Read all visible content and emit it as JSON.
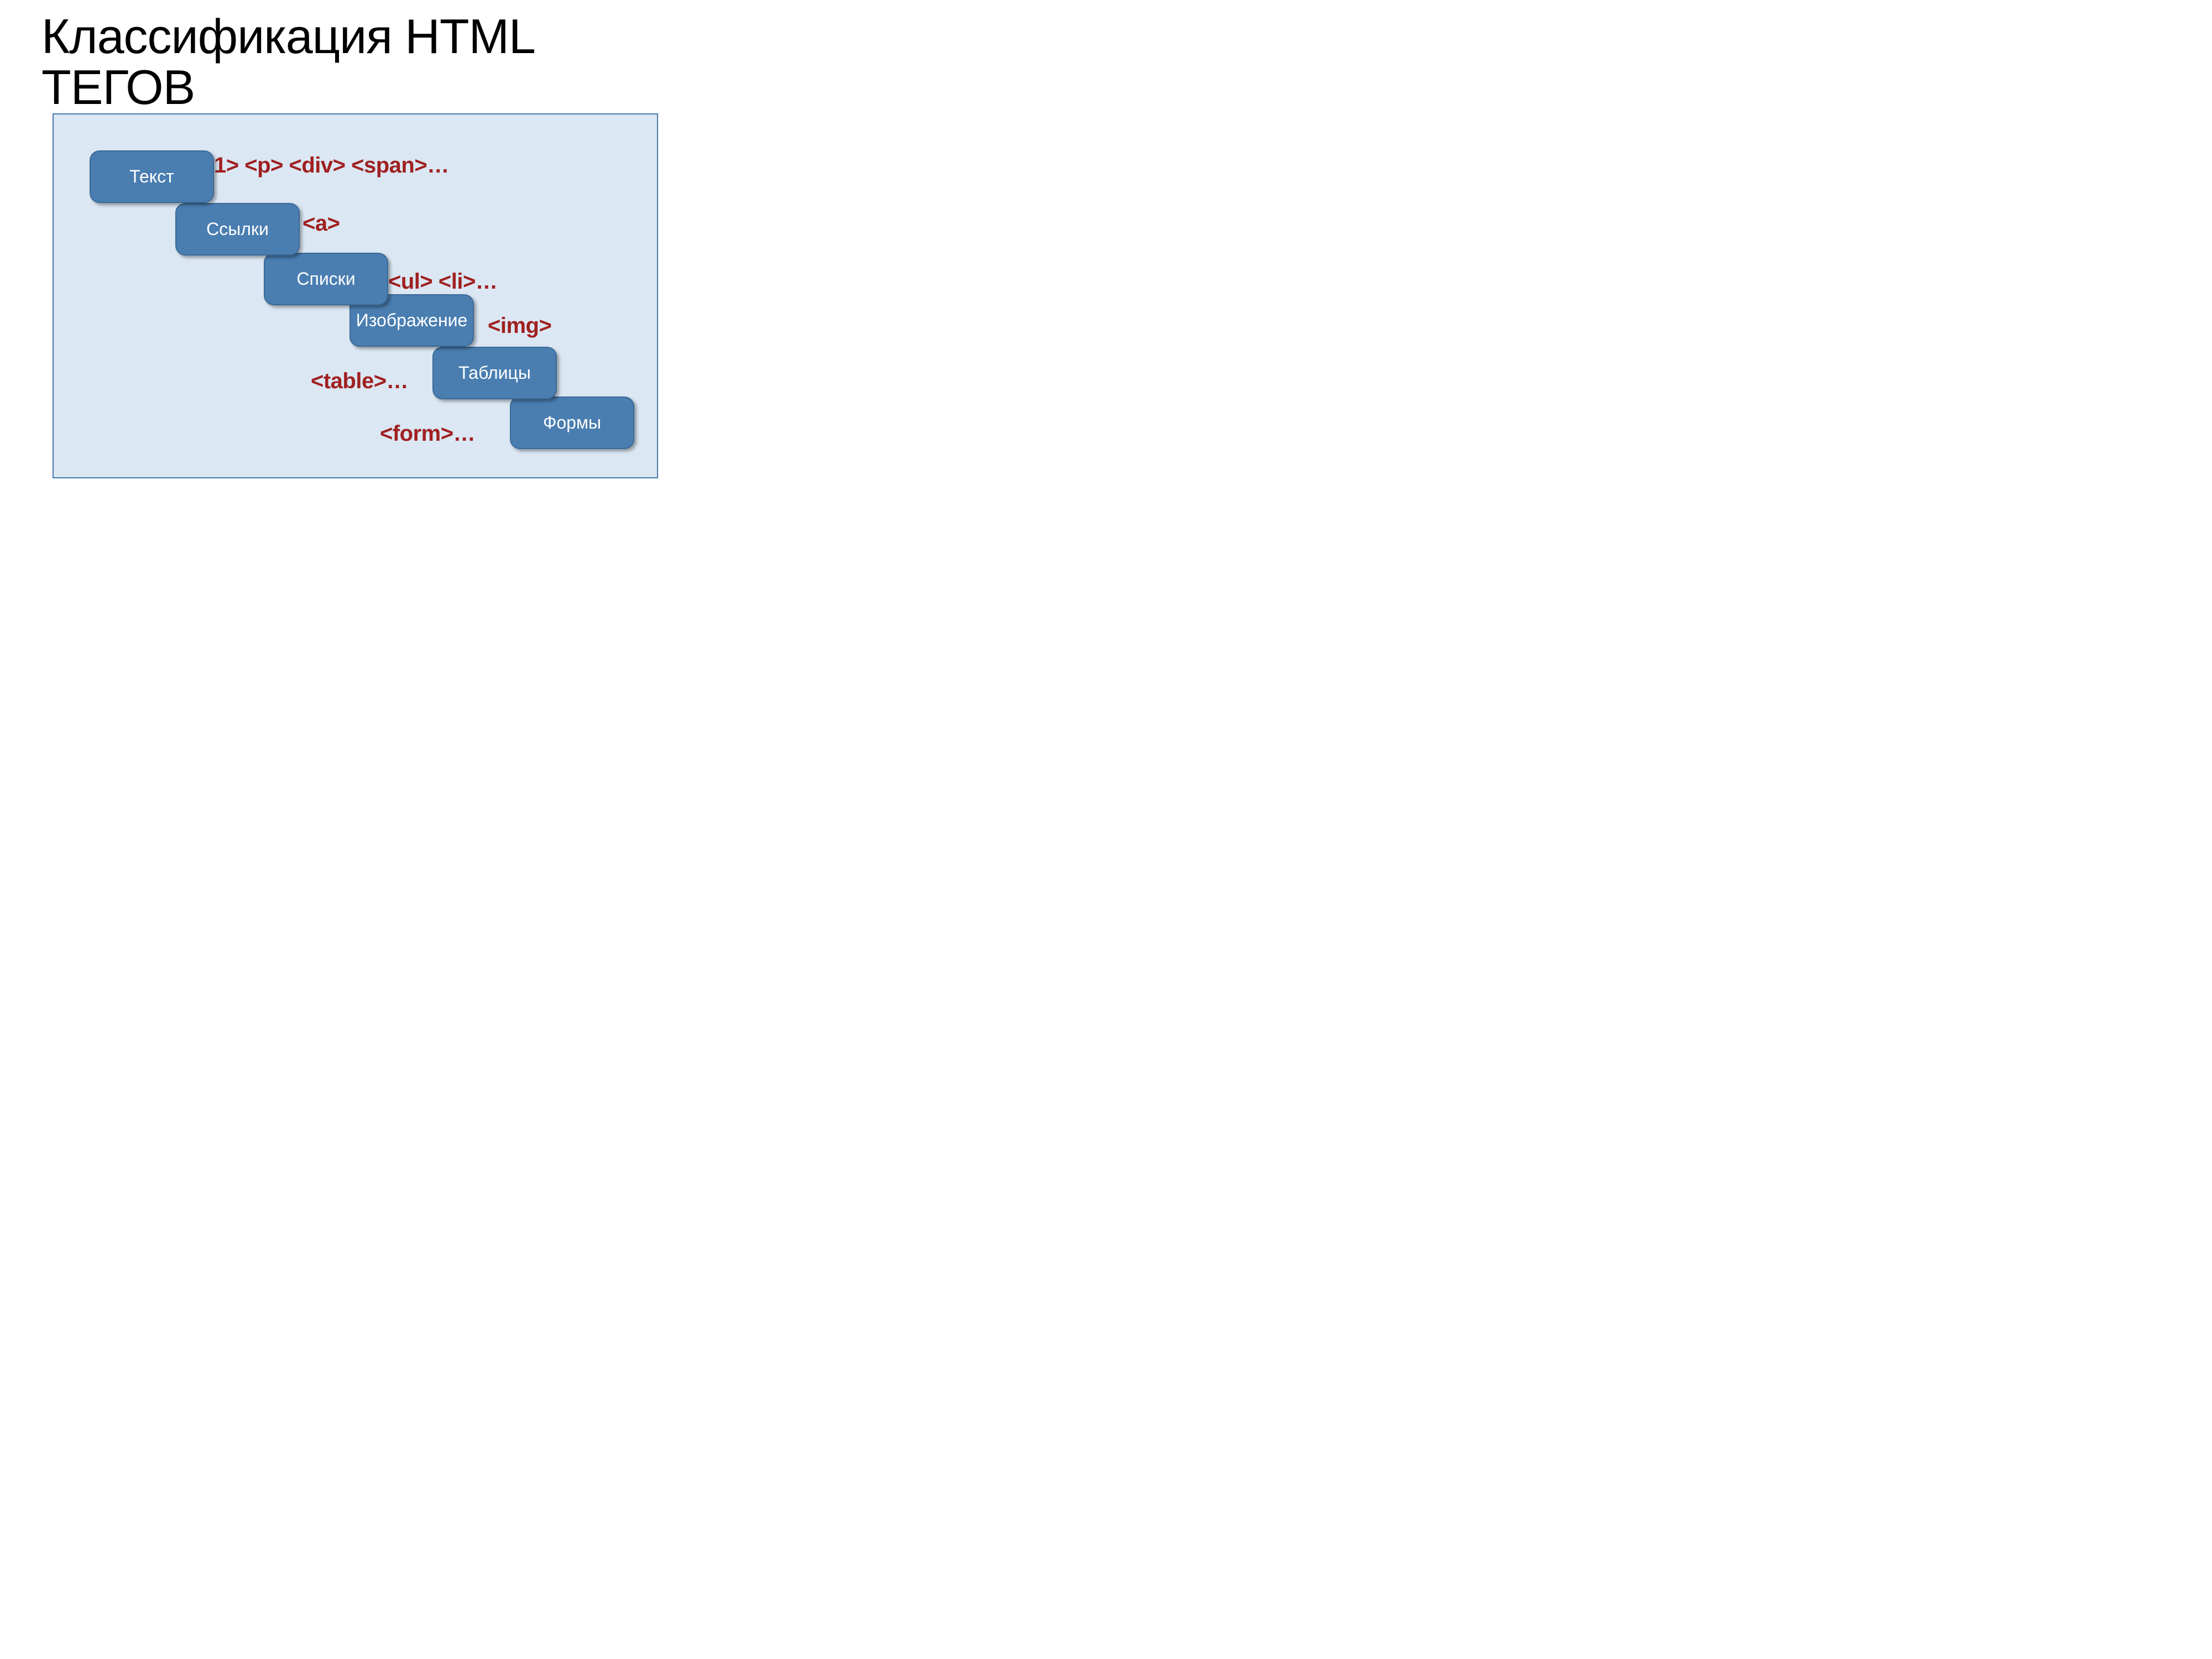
{
  "title": "Классификация HTML ТЕГОВ",
  "boxes": {
    "text": "Текст",
    "links": "Ссылки",
    "lists": "Списки",
    "images": "Изображение",
    "tables": "Таблицы",
    "forms": "Формы"
  },
  "tags": {
    "text": "1> <p> <div> <span>…",
    "links": "<a>",
    "lists": "<ul> <li>…",
    "images": "<img>",
    "tables": "<table>…",
    "forms": "<form>…"
  },
  "colors": {
    "panel_bg": "#dbe7f3",
    "panel_border": "#4678ab",
    "box_bg": "#4a7eb1",
    "box_border": "#3a6a97",
    "tag_text": "#a02020"
  }
}
